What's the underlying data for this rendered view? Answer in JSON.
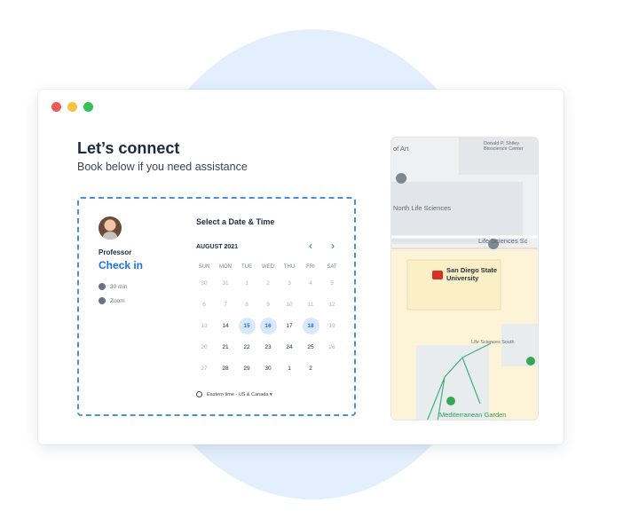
{
  "page": {
    "title": "Let’s connect",
    "subtitle": "Book below if you need assistance"
  },
  "booking": {
    "host_role": "Professor",
    "event_name": "Check in",
    "duration": "30 min",
    "location": "Zoom",
    "panel_title": "Select a Date & Time",
    "month": "AUGUST 2021",
    "weekdays": [
      "SUN",
      "MON",
      "TUE",
      "WED",
      "THU",
      "FRI",
      "SAT"
    ],
    "weeks": [
      [
        "30",
        "31",
        "1",
        "2",
        "3",
        "4",
        "5"
      ],
      [
        "6",
        "7",
        "8",
        "9",
        "10",
        "11",
        "12"
      ],
      [
        "13",
        "14",
        "15",
        "16",
        "17",
        "18",
        "19"
      ],
      [
        "20",
        "21",
        "22",
        "23",
        "24",
        "25",
        "26"
      ],
      [
        "27",
        "28",
        "29",
        "30",
        "1",
        "2"
      ]
    ],
    "timezone": "Eastern time - US & Canada ▾",
    "accent_color": "#1a73e8"
  },
  "map": {
    "labels": {
      "art": "of Art",
      "library": "Donald P. Shiley Bioscience Center",
      "north": "North Life Sciences",
      "life": "Life Sciences Sc",
      "university": "San Diego State University",
      "south": "Life Sciences South",
      "garden": "Mediterranean Garden"
    }
  }
}
